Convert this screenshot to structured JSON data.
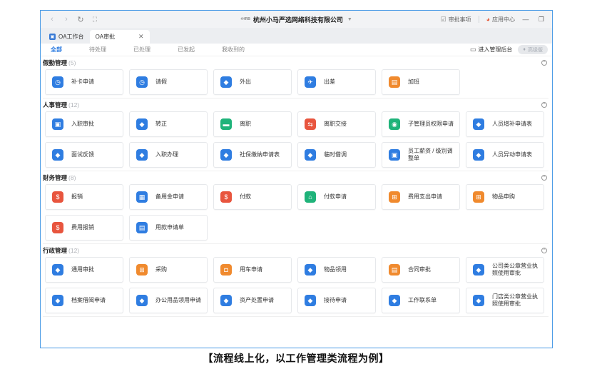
{
  "window": {
    "logo_text": "+HRB",
    "company": "杭州小马严选网络科技有限公司",
    "caret": "▼",
    "todo_label": "审批事项",
    "appcenter_label": "应用中心",
    "back_glyph": "‹",
    "fwd_glyph": "›",
    "refresh_glyph": "↻",
    "expand_glyph": "⛶",
    "min_glyph": "—",
    "restore_glyph": "❐"
  },
  "tabs": [
    {
      "label": "OA工作台",
      "fav": "▣"
    },
    {
      "label": "OA审批",
      "close": "✕"
    }
  ],
  "subnav": {
    "items": [
      "全部",
      "待处理",
      "已处理",
      "已发起",
      "我收到的"
    ],
    "manage_label": "进入管理后台",
    "pro_label": "高级版"
  },
  "sections": [
    {
      "title": "假勤管理",
      "count": "(5)",
      "items": [
        {
          "label": "补卡申请",
          "color": "#2f7de1",
          "icon": "clock-icon",
          "glyph": "◷"
        },
        {
          "label": "请假",
          "color": "#2f7de1",
          "icon": "clock-icon",
          "glyph": "◷"
        },
        {
          "label": "外出",
          "color": "#2f7de1",
          "icon": "tag-icon",
          "glyph": "◆"
        },
        {
          "label": "出差",
          "color": "#2f7de1",
          "icon": "plane-icon",
          "glyph": "✈"
        },
        {
          "label": "加班",
          "color": "#f08a2e",
          "icon": "document-icon",
          "glyph": "▤"
        }
      ]
    },
    {
      "title": "人事管理",
      "count": "(12)",
      "items": [
        {
          "label": "入职审批",
          "color": "#2f7de1",
          "icon": "person-badge-icon",
          "glyph": "▣"
        },
        {
          "label": "转正",
          "color": "#2f7de1",
          "icon": "tag-icon",
          "glyph": "◆"
        },
        {
          "label": "离职",
          "color": "#1fb37a",
          "icon": "folder-icon",
          "glyph": "▬"
        },
        {
          "label": "离职交接",
          "color": "#e8553e",
          "icon": "swap-icon",
          "glyph": "⇆"
        },
        {
          "label": "子管理员权限申请",
          "color": "#1fb37a",
          "icon": "user-icon",
          "glyph": "◉"
        },
        {
          "label": "人员增补申请表",
          "color": "#2f7de1",
          "icon": "tag-icon",
          "glyph": "◆"
        },
        {
          "label": "面试反馈",
          "color": "#2f7de1",
          "icon": "tag-icon",
          "glyph": "◆"
        },
        {
          "label": "入职办理",
          "color": "#2f7de1",
          "icon": "tag-icon",
          "glyph": "◆"
        },
        {
          "label": "社保缴纳申请表",
          "color": "#2f7de1",
          "icon": "tag-icon",
          "glyph": "◆"
        },
        {
          "label": "临时借调",
          "color": "#2f7de1",
          "icon": "tag-icon",
          "glyph": "◆"
        },
        {
          "label": "员工薪资 / 级别调整单",
          "color": "#2f7de1",
          "icon": "person-badge-icon",
          "glyph": "▣"
        },
        {
          "label": "人员异动申请表",
          "color": "#2f7de1",
          "icon": "tag-icon",
          "glyph": "◆"
        }
      ]
    },
    {
      "title": "财务管理",
      "count": "(8)",
      "items": [
        {
          "label": "报销",
          "color": "#e8553e",
          "icon": "money-bag-icon",
          "glyph": "$"
        },
        {
          "label": "备用金申请",
          "color": "#2f7de1",
          "icon": "calculator-icon",
          "glyph": "▦"
        },
        {
          "label": "付款",
          "color": "#e8553e",
          "icon": "money-bag-icon",
          "glyph": "$"
        },
        {
          "label": "付款申请",
          "color": "#1fb37a",
          "icon": "bank-icon",
          "glyph": "⌂"
        },
        {
          "label": "费用支出申请",
          "color": "#f08a2e",
          "icon": "cart-icon",
          "glyph": "⊞"
        },
        {
          "label": "物品申购",
          "color": "#f08a2e",
          "icon": "cart-icon",
          "glyph": "⊞"
        },
        {
          "label": "费用报销",
          "color": "#e8553e",
          "icon": "money-bag-icon",
          "glyph": "$"
        },
        {
          "label": "用款申请单",
          "color": "#2f7de1",
          "icon": "document-icon",
          "glyph": "▤"
        }
      ]
    },
    {
      "title": "行政管理",
      "count": "(12)",
      "items": [
        {
          "label": "通用审批",
          "color": "#2f7de1",
          "icon": "tag-icon",
          "glyph": "◆"
        },
        {
          "label": "采购",
          "color": "#f08a2e",
          "icon": "cart-icon",
          "glyph": "⊞"
        },
        {
          "label": "用车申请",
          "color": "#f08a2e",
          "icon": "car-icon",
          "glyph": "◘"
        },
        {
          "label": "物品领用",
          "color": "#2f7de1",
          "icon": "tag-icon",
          "glyph": "◆"
        },
        {
          "label": "合同审批",
          "color": "#f08a2e",
          "icon": "contract-icon",
          "glyph": "▤"
        },
        {
          "label": "公司类公章营业执照使用审批",
          "color": "#2f7de1",
          "icon": "tag-icon",
          "glyph": "◆"
        },
        {
          "label": "档案借阅申请",
          "color": "#2f7de1",
          "icon": "tag-icon",
          "glyph": "◆"
        },
        {
          "label": "办公用品领用申请",
          "color": "#2f7de1",
          "icon": "tag-icon",
          "glyph": "◆"
        },
        {
          "label": "资产处置申请",
          "color": "#2f7de1",
          "icon": "tag-icon",
          "glyph": "◆"
        },
        {
          "label": "接待申请",
          "color": "#2f7de1",
          "icon": "tag-icon",
          "glyph": "◆"
        },
        {
          "label": "工作联系单",
          "color": "#2f7de1",
          "icon": "tag-icon",
          "glyph": "◆"
        },
        {
          "label": "门店类公章营业执照使用审批",
          "color": "#2f7de1",
          "icon": "tag-icon",
          "glyph": "◆"
        }
      ]
    }
  ],
  "collapse_glyph": "^",
  "caption": "【流程线上化，以工作管理类流程为例】"
}
